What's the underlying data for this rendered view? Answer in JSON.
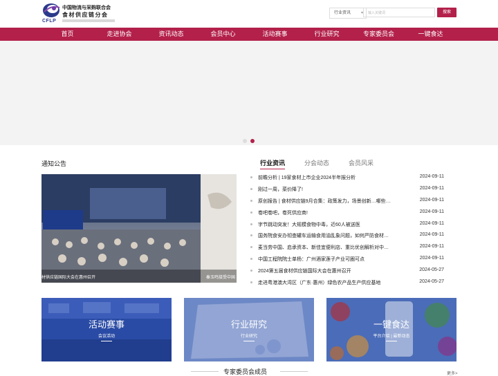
{
  "header": {
    "logo_abbr": "CFLP",
    "logo_line1": "中国物流与采购联合会",
    "logo_line2": "食材供应链分会",
    "search_category": "行业资讯",
    "search_placeholder": "输入关键词",
    "search_button": "搜索"
  },
  "nav": {
    "items": [
      "首页",
      "走进协会",
      "资讯动态",
      "会员中心",
      "活动赛事",
      "行业研究",
      "专家委员会",
      "一键食达"
    ]
  },
  "notice": {
    "title": "通知公告"
  },
  "photo": {
    "caption_left": "材供应链国际大会在惠州召开",
    "caption_right": "秦玉鸣接受中国"
  },
  "news_tabs": [
    "行业资讯",
    "分会动态",
    "会员风采"
  ],
  "news": [
    {
      "title": "前瞻分析 | 19家食材上市企业2024半年报分析",
      "date": "2024-09-11"
    },
    {
      "title": "刚过一周，菜价降了!",
      "date": "2024-09-11"
    },
    {
      "title": "原创报告 | 食材供应链9月合集：政策发力，场景创新…哪些…",
      "date": "2024-09-11"
    },
    {
      "title": "卷吧卷吧，卷死供应商!",
      "date": "2024-09-11"
    },
    {
      "title": "字节跳动突发！大规模食物中毒，近60人被送医",
      "date": "2024-09-11"
    },
    {
      "title": "国务院食安办彻查罐车运输食用油乱象问题，如何严防食材…",
      "date": "2024-09-11"
    },
    {
      "title": "麦当劳中国、启承资本、新佳宜便利店、重比优创解析对中…",
      "date": "2024-09-11"
    },
    {
      "title": "中国工程院院士单杨：广州酒家莲子产业可圈可点",
      "date": "2024-09-11"
    },
    {
      "title": "2024第五届食材供应链国际大会在惠州召开",
      "date": "2024-05-27"
    },
    {
      "title": "走进粤港澳大湾区（广东·惠州）绿色农产品生产供应基地",
      "date": "2024-05-27"
    }
  ],
  "cards": [
    {
      "title": "活动赛事",
      "sub": "会议活动"
    },
    {
      "title": "行业研究",
      "sub": "行业研究"
    },
    {
      "title": "一键食达",
      "sub": "平台介绍 | 最新动态"
    }
  ],
  "experts": {
    "title": "专家委员会成员",
    "more": "更多>"
  },
  "colors": {
    "brand": "#b3204a"
  }
}
